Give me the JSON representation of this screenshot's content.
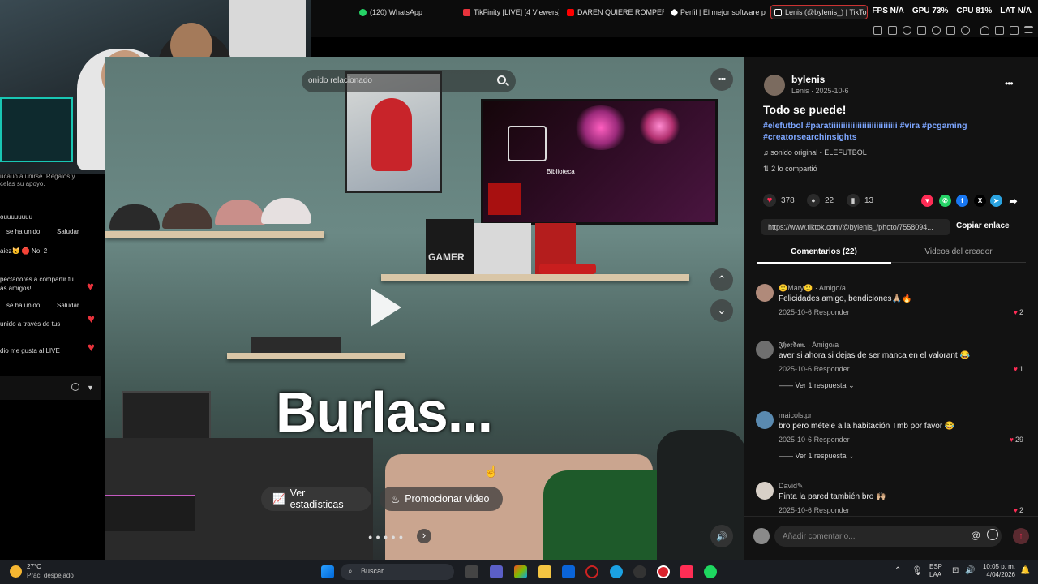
{
  "browser": {
    "tabs": [
      {
        "label": "(120) WhatsApp",
        "color": "#25d366"
      },
      {
        "label": "TikFinity [LIVE] [4 Viewers]",
        "color": "#e8333c"
      },
      {
        "label": "DAREN QUIERE ROMPER",
        "color": "#ff0000"
      },
      {
        "label": "Perfil | El mejor software p",
        "color": "#ffffff"
      },
      {
        "label": "Lenis (@bylenis_) | TikTok",
        "color": "#ffffff"
      }
    ],
    "stats": {
      "fps_label": "FPS",
      "fps_value": "N/A",
      "gpu_label": "GPU",
      "gpu_value": "73%",
      "cpu_label": "CPU",
      "cpu_value": "81%",
      "lat_label": "LAT",
      "lat_value": "N/A"
    }
  },
  "live_chat": {
    "lines": [
      "ucauo a unirse. Regalos y",
      "celas su apoyo.",
      "ouuuuuuuu",
      "se ha unido",
      "Saludar",
      "aiez🐱 🛑 No. 2",
      "pectadores a compartir tu",
      "ás amigos!",
      "se ha unido",
      "Saludar",
      "unido a través de tus",
      "dio me gusta al LIVE"
    ]
  },
  "video": {
    "search_placeholder": "onido relacionado",
    "caption": "Burlas...",
    "tv_label": "Biblioteca",
    "stats_button": "Ver estadísticas",
    "promote_button": "Promocionar video",
    "prev_button": "‹",
    "next_button": "›",
    "more_icon": "•••",
    "up_icon": "⌃",
    "down_icon": "⌄",
    "volume_icon": "🔊"
  },
  "post": {
    "username": "bylenis_",
    "display_name": "Lenis",
    "date": "2025-10-6",
    "title": "Todo se puede!",
    "hashtags_line1": "#elefutbol #paratiiiiiiiiiiiiiiiiiiiiiiiiiiii #vira #pcgaming",
    "hashtags_line2": "#creatorsearchinsights",
    "sound": "sonido original - ELEFUTBOL",
    "shared": "2 lo compartió",
    "likes": "378",
    "comments_count": "22",
    "saves": "13",
    "url": "https://www.tiktok.com/@bylenis_/photo/7558094...",
    "copy_link": "Copiar enlace",
    "tab_comments": "Comentarios (22)",
    "tab_videos": "Videos del creador",
    "comment_placeholder": "Añadir comentario...",
    "comments": [
      {
        "name": "🙂Mary🙂 · Amigo/a",
        "text": "Felicidades amigo, bendiciones🙏🏼🔥",
        "date": "2025-10-6",
        "reply_label": "Responder",
        "likes": "2",
        "replies": ""
      },
      {
        "name": "𝕵𝖍𝖔𝖗𝖉𝖆𝖓. · Amigo/a",
        "text": "aver si ahora si dejas de ser manca en el valorant 😂",
        "date": "2025-10-6",
        "reply_label": "Responder",
        "likes": "1",
        "replies": "Ver 1 respuesta"
      },
      {
        "name": "maicolstpr",
        "text": "bro pero métele a la habitación Tmb por favor 😂",
        "date": "2025-10-6",
        "reply_label": "Responder",
        "likes": "29",
        "replies": "Ver 1 respuesta"
      },
      {
        "name": "David✎",
        "text": "Pinta la pared también bro 🙌🏼",
        "date": "2025-10-6",
        "reply_label": "Responder",
        "likes": "2",
        "replies": ""
      }
    ]
  },
  "taskbar": {
    "weather_temp": "27°C",
    "weather_desc": "Prac. despejado",
    "search": "Buscar",
    "lang1": "ESP",
    "lang2": "LAA",
    "time": "10:05 p. m.",
    "date": "4/04/2026"
  }
}
